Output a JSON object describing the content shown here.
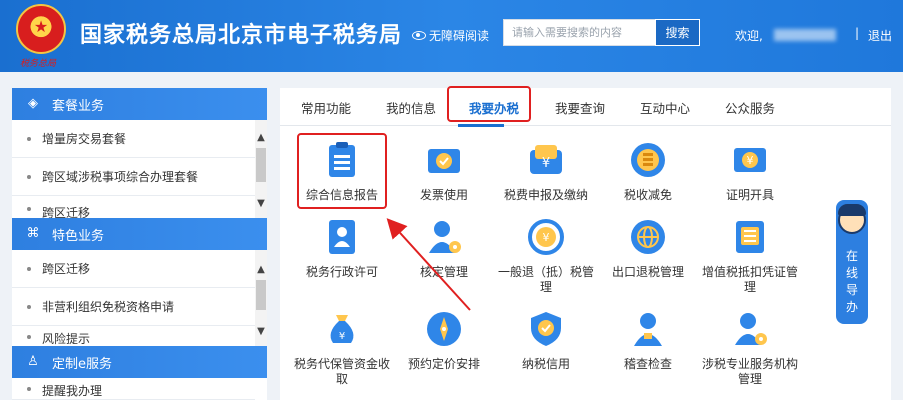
{
  "header": {
    "site_title": "国家税务总局北京市电子税务局",
    "seal_text": "税务总局",
    "accessible_label": "无障碍阅读",
    "search_placeholder": "请输入需要搜索的内容",
    "search_button": "搜索",
    "welcome": "欢迎,",
    "divider": "|",
    "logout": "退出",
    "colors": {
      "bar": "#1f78db",
      "search_button": "#1b69c4"
    }
  },
  "sidebar": {
    "sections": [
      {
        "title": "套餐业务",
        "icon": "layers-icon",
        "items": [
          "增量房交易套餐",
          "跨区域涉税事项综合办理套餐",
          "跨区迁移"
        ]
      },
      {
        "title": "特色业务",
        "icon": "clover-icon",
        "items": [
          "跨区迁移",
          "非营利组织免税资格申请",
          "风险提示"
        ]
      },
      {
        "title": "定制e服务",
        "icon": "user-icon",
        "items": [
          "提醒我办理"
        ]
      }
    ]
  },
  "tabs": {
    "items": [
      "常用功能",
      "我的信息",
      "我要办税",
      "我要查询",
      "互动中心",
      "公众服务"
    ],
    "active": "我要办税"
  },
  "tiles": [
    {
      "label": "综合信息报告",
      "icon": "clipboard-icon",
      "highlighted": true
    },
    {
      "label": "发票使用",
      "icon": "invoice-check-icon"
    },
    {
      "label": "税费申报及缴纳",
      "icon": "yuan-wallet-icon"
    },
    {
      "label": "税收减免",
      "icon": "coin-stack-icon"
    },
    {
      "label": "证明开具",
      "icon": "yuan-ticket-icon"
    },
    {
      "label": "税务行政许可",
      "icon": "id-card-icon"
    },
    {
      "label": "核定管理",
      "icon": "user-gear-icon"
    },
    {
      "label": "一般退（抵）税管理",
      "icon": "yuan-cycle-icon"
    },
    {
      "label": "出口退税管理",
      "icon": "globe-icon"
    },
    {
      "label": "增值税抵扣凭证管理",
      "icon": "voucher-icon"
    },
    {
      "label": "税务代保管资金收取",
      "icon": "money-bag-icon"
    },
    {
      "label": "预约定价安排",
      "icon": "compass-icon"
    },
    {
      "label": "纳税信用",
      "icon": "shield-check-icon"
    },
    {
      "label": "稽查检查",
      "icon": "inspector-icon"
    },
    {
      "label": "涉税专业服务机构管理",
      "icon": "user-gear-icon"
    }
  ],
  "guide": {
    "text": [
      "在",
      "线",
      "导",
      "办"
    ]
  },
  "accent_color": "#1a6fd0",
  "highlight_color": "#e02020"
}
